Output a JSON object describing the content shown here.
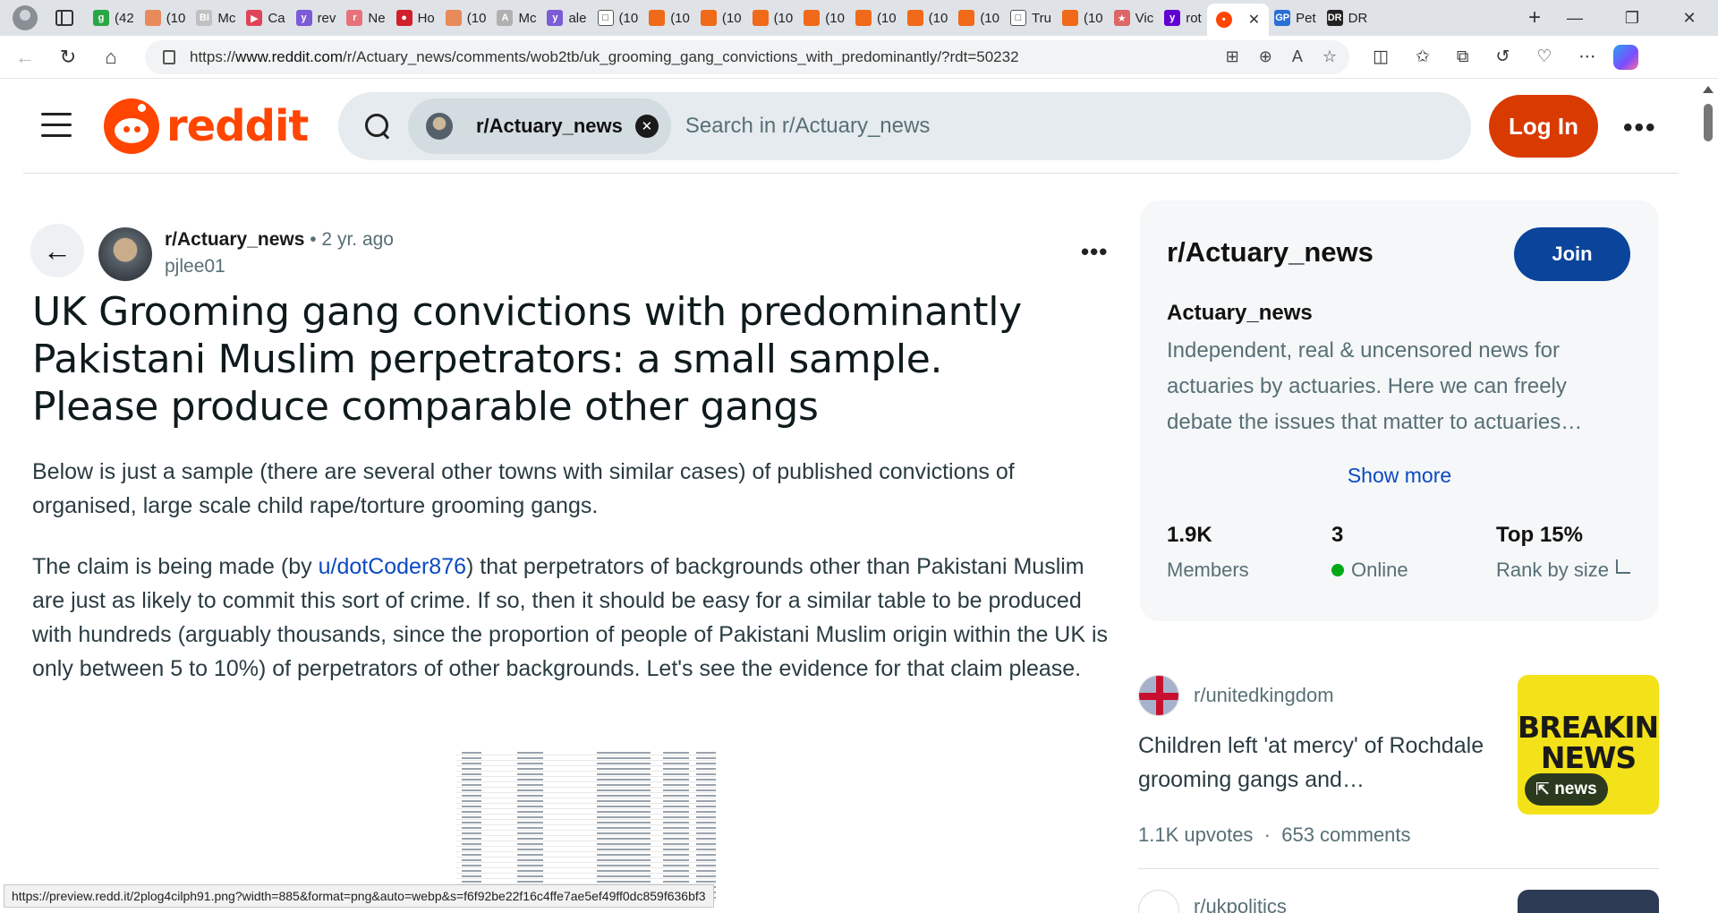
{
  "browser": {
    "tabs": [
      {
        "label": "(42",
        "fav": "g",
        "color": "#28a745"
      },
      {
        "label": "(10",
        "fav": "",
        "color": "#e88a5a"
      },
      {
        "label": "Mc",
        "fav": "BI",
        "color": "#c0c0c0"
      },
      {
        "label": "Ca",
        "fav": "▶",
        "color": "#e0445a"
      },
      {
        "label": "rev",
        "fav": "y",
        "color": "#7b5bd6"
      },
      {
        "label": "Ne",
        "fav": "r",
        "color": "#e8727a"
      },
      {
        "label": "Ho",
        "fav": "●",
        "color": "#d0202a"
      },
      {
        "label": "(10",
        "fav": "",
        "color": "#e88a5a"
      },
      {
        "label": "Mc",
        "fav": "A",
        "color": "#b0b0b0"
      },
      {
        "label": "ale",
        "fav": "y",
        "color": "#7b5bd6"
      },
      {
        "label": "(10",
        "fav": "□",
        "color": "#ffffff"
      },
      {
        "label": "(10",
        "fav": "",
        "color": "#f06a1a"
      },
      {
        "label": "(10",
        "fav": "",
        "color": "#f06a1a"
      },
      {
        "label": "(10",
        "fav": "",
        "color": "#f06a1a"
      },
      {
        "label": "(10",
        "fav": "",
        "color": "#f06a1a"
      },
      {
        "label": "(10",
        "fav": "",
        "color": "#f06a1a"
      },
      {
        "label": "(10",
        "fav": "",
        "color": "#f06a1a"
      },
      {
        "label": "(10",
        "fav": "",
        "color": "#f06a1a"
      },
      {
        "label": "Tru",
        "fav": "□",
        "color": "#ffffff"
      },
      {
        "label": "(10",
        "fav": "",
        "color": "#f06a1a"
      },
      {
        "label": "Vic",
        "fav": "★",
        "color": "#d66"
      },
      {
        "label": "rot",
        "fav": "y",
        "color": "#6001d2"
      }
    ],
    "active_tab": {
      "label": "",
      "close": "✕"
    },
    "extra_tabs": [
      {
        "label": "Pet",
        "fav": "GP",
        "color": "#2a6fd6"
      },
      {
        "label": "DR",
        "fav": "DR",
        "color": "#222"
      }
    ],
    "new_tab": "+",
    "window_controls": {
      "minimize": "—",
      "restore": "❐",
      "close": "✕"
    },
    "url_prefix": "https://",
    "url_host": "www.reddit.com",
    "url_path": "/r/Actuary_news/comments/wob2tb/uk_grooming_gang_convictions_with_predominantly/?rdt=50232"
  },
  "header": {
    "logo_word": "reddit",
    "search_chip": "r/Actuary_news",
    "search_placeholder": "Search in r/Actuary_news",
    "login_label": "Log In",
    "more": "•••"
  },
  "post": {
    "subreddit": "r/Actuary_news",
    "time": "• 2 yr. ago",
    "author": "pjlee01",
    "more": "•••",
    "title": "UK Grooming gang convictions with predominantly Pakistani Muslim perpetrators: a small sample. Please produce comparable other gangs",
    "para1": "Below is just a sample (there are several other towns with similar cases) of published convictions of organised, large scale child rape/torture grooming gangs.",
    "para2_before": "The claim is being made (by ",
    "para2_link": "u/dotCoder876",
    "para2_after": ") that perpetrators of backgrounds other than Pakistani Muslim are just as likely to commit this sort of crime. If so, then it should be easy for a similar table to be produced with hundreds (arguably thousands, since the proportion of people of Pakistani Muslim origin within the UK is only between 5 to 10%) of perpetrators of other backgrounds. Let's see the evidence for that claim please."
  },
  "status_url": "https://preview.redd.it/2plog4cilph91.png?width=885&format=png&auto=webp&s=f6f92be22f16c4ffe7ae5ef49ff0dc859f636bf3",
  "sidebar": {
    "community": "r/Actuary_news",
    "join_label": "Join",
    "title": "Actuary_news",
    "description": "Independent, real & uncensored news for actuaries by actuaries. Here we can freely debate the issues that matter to actuaries…",
    "show_more": "Show more",
    "stats": [
      {
        "value": "1.9K",
        "label": "Members"
      },
      {
        "value": "3",
        "label": "Online"
      },
      {
        "value": "Top 15%",
        "label": "Rank by size"
      }
    ]
  },
  "related": {
    "subreddit": "r/unitedkingdom",
    "title": "Children left 'at mercy' of Rochdale grooming gangs and…",
    "thumb_line1": "BREAKING",
    "thumb_line2": "NEWS",
    "thumb_badge": "news",
    "upvotes": "1.1K upvotes",
    "sep": "·",
    "comments": "653 comments",
    "next_subreddit": "r/ukpolitics"
  }
}
